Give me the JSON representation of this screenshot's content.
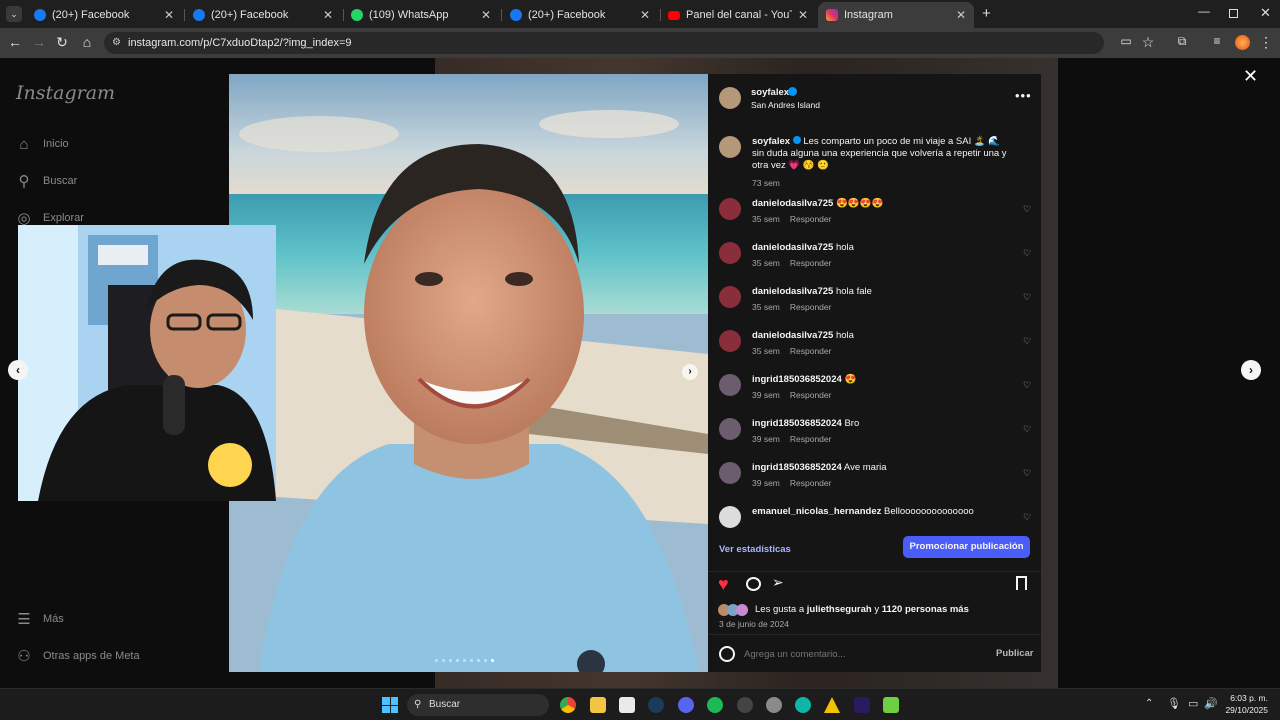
{
  "browser": {
    "tabs": [
      {
        "label": "(20+) Facebook",
        "icon": "facebook-icon",
        "color": "#1877f2"
      },
      {
        "label": "(20+) Facebook",
        "icon": "facebook-icon",
        "color": "#1877f2"
      },
      {
        "label": "(109) WhatsApp",
        "icon": "whatsapp-icon",
        "color": "#25d366"
      },
      {
        "label": "(20+) Facebook",
        "icon": "facebook-icon",
        "color": "#1877f2"
      },
      {
        "label": "Panel del canal - YouTube Studi",
        "icon": "youtube-icon",
        "color": "#ff0000"
      },
      {
        "label": "Instagram",
        "icon": "instagram-icon",
        "color": "#e1306c"
      }
    ],
    "url": "instagram.com/p/C7xduoDtap2/?img_index=9"
  },
  "ig_nav": {
    "logo": "Instagram",
    "items": [
      {
        "label": "Inicio",
        "icon": "home-icon"
      },
      {
        "label": "Buscar",
        "icon": "search-icon"
      },
      {
        "label": "Explorar",
        "icon": "compass-icon"
      }
    ],
    "bottom": [
      {
        "label": "Más",
        "icon": "menu-icon"
      },
      {
        "label": "Otras apps de Meta",
        "icon": "meta-apps-icon"
      }
    ]
  },
  "post": {
    "author": "soyfalex",
    "location": "San Andres Island",
    "caption_user": "soyfalex",
    "caption_text": "Les comparto un poco de mi viaje a SAI 🏝️ 🌊sin duda alguna una experiencia que volvería a repetir una y otra vez 💗 😚 🙂",
    "caption_time": "73 sem",
    "comments": [
      {
        "user": "danielodasilva725",
        "text": "😍😍😍😍",
        "time": "35 sem",
        "reply": "Responder"
      },
      {
        "user": "danielodasilva725",
        "text": "hola",
        "time": "35 sem",
        "reply": "Responder"
      },
      {
        "user": "danielodasilva725",
        "text": "hola fale",
        "time": "35 sem",
        "reply": "Responder"
      },
      {
        "user": "danielodasilva725",
        "text": "hola",
        "time": "35 sem",
        "reply": "Responder"
      },
      {
        "user": "ingrid185036852024",
        "text": "😍",
        "time": "39 sem",
        "reply": "Responder"
      },
      {
        "user": "ingrid185036852024",
        "text": "Bro",
        "time": "39 sem",
        "reply": "Responder"
      },
      {
        "user": "ingrid185036852024",
        "text": "Ave maria",
        "time": "39 sem",
        "reply": "Responder"
      },
      {
        "user": "emanuel_nicolas_hernandez",
        "text": "Belloooooooooooooo",
        "time": "",
        "reply": ""
      }
    ],
    "stats_link": "Ver estadísticas",
    "promote_button": "Promocionar publicación",
    "likes_prefix": "Les gusta a ",
    "likes_user": "juliethsegurah",
    "likes_mid": " y ",
    "likes_count": "1120 personas más",
    "date": "3 de junio de 2024",
    "comment_placeholder": "Agrega un comentario...",
    "publish_button": "Publicar",
    "carousel_dots": 9,
    "carousel_active_index": 8
  },
  "taskbar": {
    "search_label": "Buscar",
    "time": "6:03 p. m.",
    "date": "29/10/2025"
  },
  "colors": {
    "accent": "#4a5df9",
    "like": "#ff3040",
    "verified": "#0095f6"
  }
}
